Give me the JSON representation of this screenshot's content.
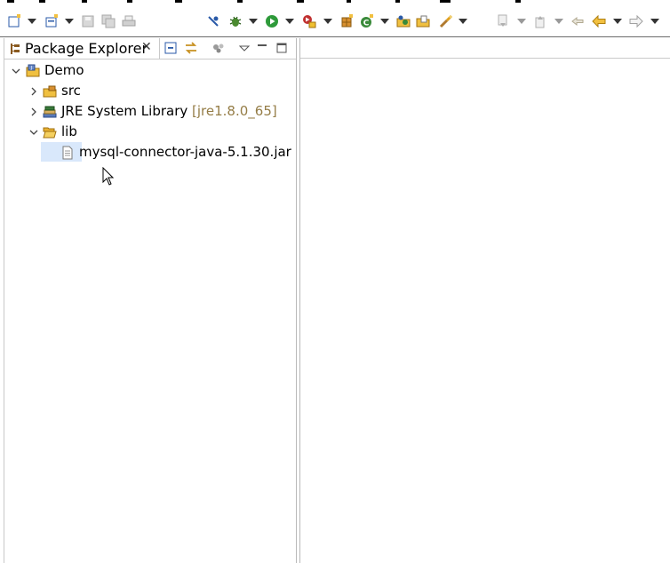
{
  "toolbar": {
    "icons": [
      "new-icon",
      "new-java-element-icon",
      "save-icon",
      "save-all-icon",
      "print-icon",
      "skip-breakpoints-icon",
      "debug-icon",
      "run-icon",
      "coverage-icon",
      "external-tools-icon",
      "new-java-package-icon",
      "new-java-class-icon",
      "open-type-icon",
      "search-icon",
      "next-annotation-icon",
      "previous-annotation-icon",
      "last-edit-location-icon",
      "back-icon",
      "forward-icon"
    ]
  },
  "package_explorer": {
    "tab_label": "Package Explorer",
    "close_glyph": "✕",
    "tree": [
      {
        "label": "Demo",
        "level": 0,
        "expanded": true,
        "icon": "java-project-icon"
      },
      {
        "label": "src",
        "level": 1,
        "expanded": false,
        "icon": "source-folder-icon"
      },
      {
        "label": "JRE System Library",
        "decoration": "[jre1.8.0_65]",
        "level": 1,
        "expanded": false,
        "icon": "library-icon"
      },
      {
        "label": "lib",
        "level": 1,
        "expanded": true,
        "selected": true,
        "icon": "folder-open-icon"
      },
      {
        "label": "mysql-connector-java-5.1.30.jar",
        "level": 2,
        "icon": "file-icon"
      }
    ]
  },
  "colors": {
    "selection": "#d9e8fb",
    "decoration": "#957d47"
  }
}
